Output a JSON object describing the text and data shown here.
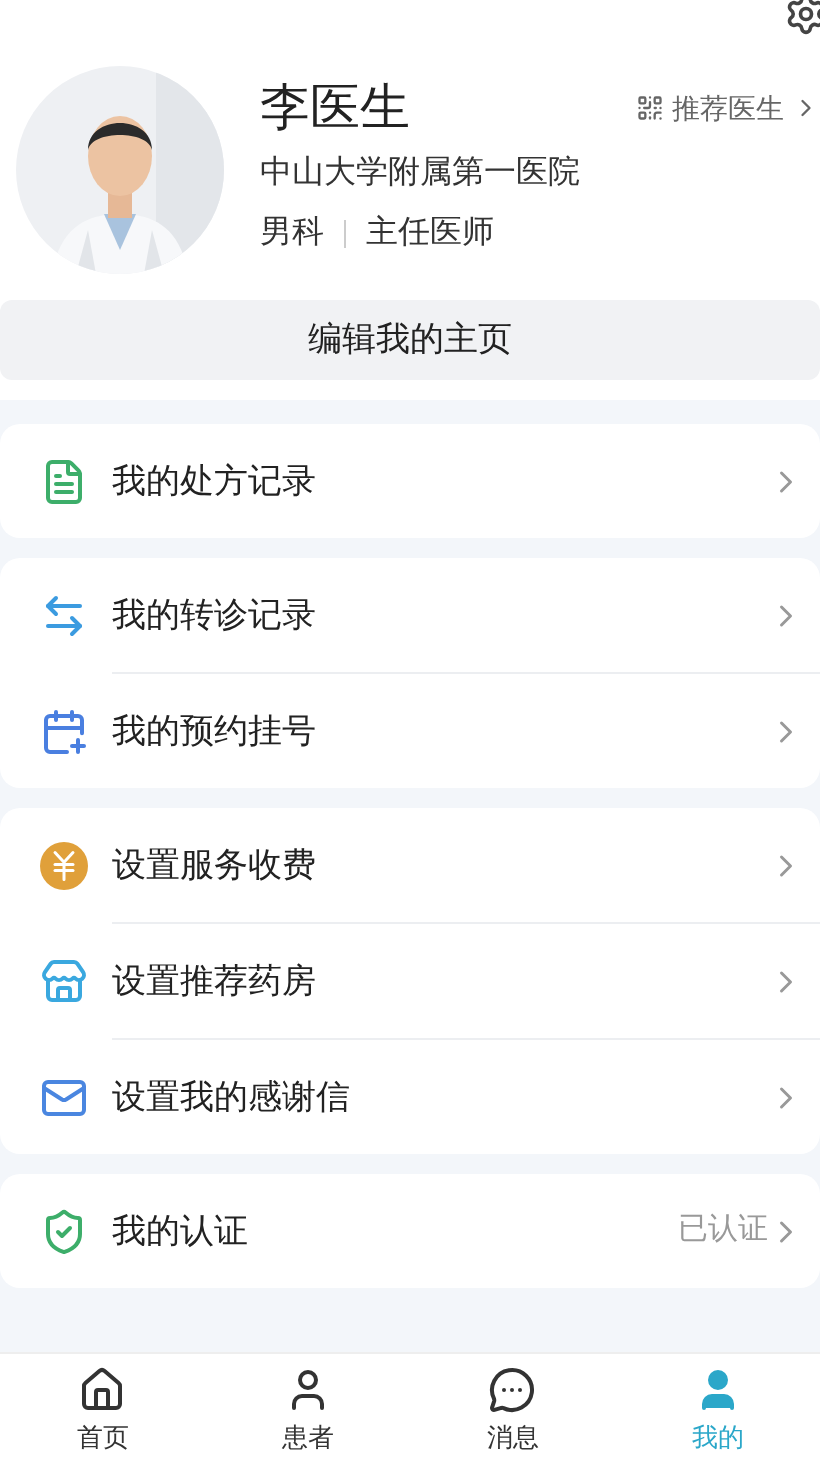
{
  "profile": {
    "name": "李医生",
    "hospital": "中山大学附属第一医院",
    "department": "男科",
    "title": "主任医师",
    "recommend_link": "推荐医生",
    "edit_button": "编辑我的主页"
  },
  "groups": [
    {
      "items": [
        {
          "label": "我的处方记录"
        }
      ]
    },
    {
      "items": [
        {
          "label": "我的转诊记录"
        },
        {
          "label": "我的预约挂号"
        }
      ]
    },
    {
      "items": [
        {
          "label": "设置服务收费"
        },
        {
          "label": "设置推荐药房"
        },
        {
          "label": "设置我的感谢信"
        }
      ]
    },
    {
      "items": [
        {
          "label": "我的认证",
          "value": "已认证"
        }
      ]
    }
  ],
  "tab_bar": [
    {
      "label": "首页",
      "selected": false
    },
    {
      "label": "患者",
      "selected": false
    },
    {
      "label": "消息",
      "selected": false
    },
    {
      "label": "我的",
      "selected": true
    }
  ]
}
